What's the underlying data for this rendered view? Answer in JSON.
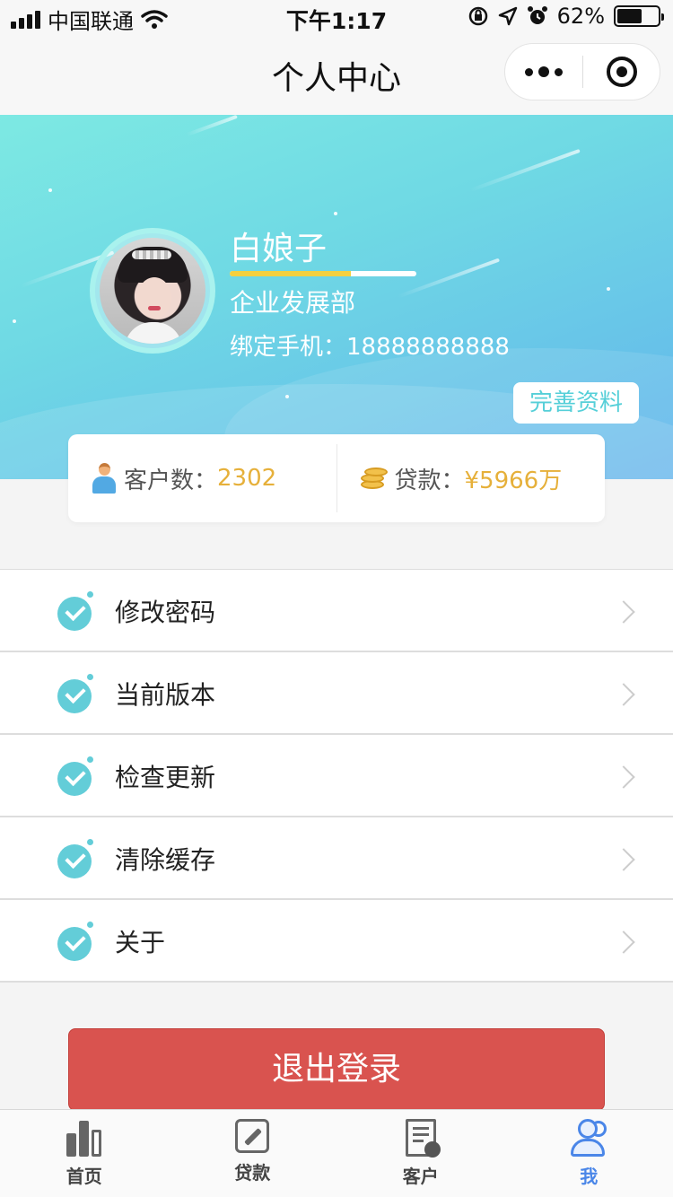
{
  "status_bar": {
    "carrier": "中国联通",
    "time": "下午1:17",
    "battery_percent": "62%",
    "battery_level": 0.62,
    "icons": [
      "signal-icon",
      "wifi-icon",
      "orientation-lock-icon",
      "location-icon",
      "alarm-icon",
      "battery-icon"
    ]
  },
  "navbar": {
    "title": "个人中心",
    "menu_icon": "more-dots-icon",
    "close_icon": "close-circle-icon"
  },
  "profile": {
    "name": "白娘子",
    "level_progress": 0.65,
    "department": "企业发展部",
    "phone_label": "绑定手机：",
    "phone": "18888888888",
    "complete_button": "完善资料"
  },
  "stats": {
    "customers_label": "客户数：",
    "customers_value": "2302",
    "loans_label": "贷款：",
    "loans_value": "¥5966万"
  },
  "menu": {
    "items": [
      {
        "label": "修改密码"
      },
      {
        "label": "当前版本"
      },
      {
        "label": "检查更新"
      },
      {
        "label": "清除缓存"
      },
      {
        "label": "关于"
      }
    ]
  },
  "logout_button": "退出登录",
  "tabbar": {
    "tabs": [
      {
        "label": "首页",
        "icon": "bar-chart-icon"
      },
      {
        "label": "贷款",
        "icon": "edit-icon"
      },
      {
        "label": "客户",
        "icon": "customer-document-icon"
      },
      {
        "label": "我",
        "icon": "user-icon",
        "active": true
      }
    ]
  },
  "colors": {
    "accent": "#4a86e8",
    "value_gold": "#e6b03a",
    "logout_red": "#d9534f",
    "teal": "#63cdd8"
  }
}
